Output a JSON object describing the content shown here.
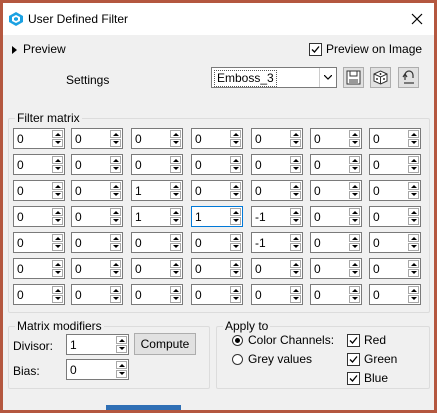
{
  "window": {
    "title": "User Defined Filter"
  },
  "preview": {
    "label": "Preview",
    "preview_on_image_label": "Preview on Image",
    "preview_on_image_checked": true
  },
  "settings": {
    "label": "Settings",
    "preset_value": "Emboss_3"
  },
  "filter_matrix": {
    "legend": "Filter matrix",
    "rows": [
      [
        "0",
        "0",
        "0",
        "0",
        "0",
        "0",
        "0"
      ],
      [
        "0",
        "0",
        "0",
        "0",
        "0",
        "0",
        "0"
      ],
      [
        "0",
        "0",
        "1",
        "0",
        "0",
        "0",
        "0"
      ],
      [
        "0",
        "0",
        "1",
        "1",
        "-1",
        "0",
        "0"
      ],
      [
        "0",
        "0",
        "0",
        "0",
        "-1",
        "0",
        "0"
      ],
      [
        "0",
        "0",
        "0",
        "0",
        "0",
        "0",
        "0"
      ],
      [
        "0",
        "0",
        "0",
        "0",
        "0",
        "0",
        "0"
      ]
    ]
  },
  "modifiers": {
    "legend": "Matrix modifiers",
    "divisor_label": "Divisor:",
    "divisor_value": "1",
    "bias_label": "Bias:",
    "bias_value": "0",
    "compute_label": "Compute"
  },
  "apply_to": {
    "legend": "Apply to",
    "color_channels_label": "Color Channels:",
    "grey_values_label": "Grey values",
    "selected": "color_channels",
    "red_label": "Red",
    "green_label": "Green",
    "blue_label": "Blue"
  }
}
